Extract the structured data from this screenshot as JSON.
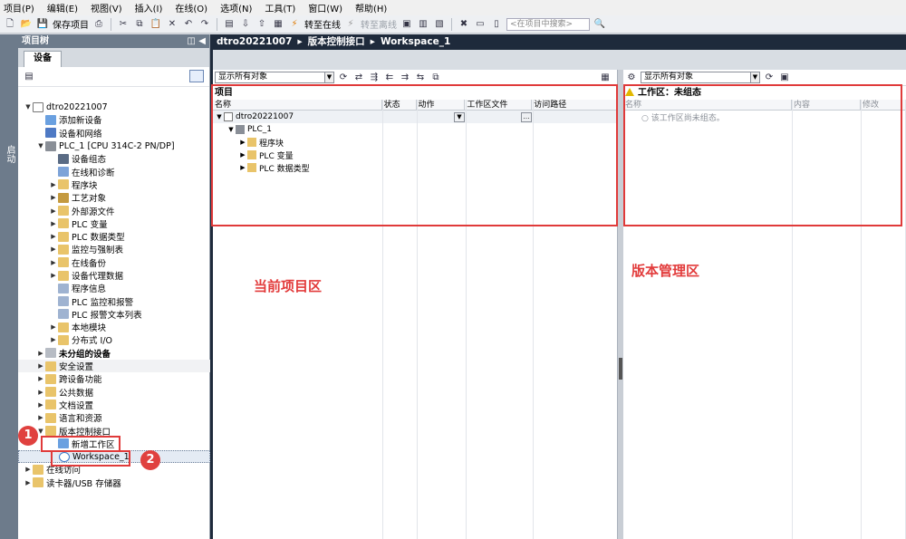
{
  "menu": [
    "项目(P)",
    "编辑(E)",
    "视图(V)",
    "插入(I)",
    "在线(O)",
    "选项(N)",
    "工具(T)",
    "窗口(W)",
    "帮助(H)"
  ],
  "toolbar": {
    "save_label": "保存项目",
    "go_online": "转至在线",
    "go_offline": "转至离线",
    "search_placeholder": "<在项目中搜索>"
  },
  "side_strip": {
    "label": "启动"
  },
  "tree": {
    "header": "项目树",
    "tab": "设备",
    "items": [
      {
        "label": "dtro20221007",
        "indent": 0,
        "arrow": "▼",
        "icon": "project"
      },
      {
        "label": "添加新设备",
        "indent": 1,
        "arrow": "",
        "icon": "add"
      },
      {
        "label": "设备和网络",
        "indent": 1,
        "arrow": "",
        "icon": "net"
      },
      {
        "label": "PLC_1 [CPU 314C-2 PN/DP]",
        "indent": 1,
        "arrow": "▼",
        "icon": "plc"
      },
      {
        "label": "设备组态",
        "indent": 2,
        "arrow": "",
        "icon": "cfg"
      },
      {
        "label": "在线和诊断",
        "indent": 2,
        "arrow": "",
        "icon": "diag"
      },
      {
        "label": "程序块",
        "indent": 2,
        "arrow": "▶",
        "icon": "folder"
      },
      {
        "label": "工艺对象",
        "indent": 2,
        "arrow": "▶",
        "icon": "tech"
      },
      {
        "label": "外部源文件",
        "indent": 2,
        "arrow": "▶",
        "icon": "folder"
      },
      {
        "label": "PLC 变量",
        "indent": 2,
        "arrow": "▶",
        "icon": "folder"
      },
      {
        "label": "PLC 数据类型",
        "indent": 2,
        "arrow": "▶",
        "icon": "folder"
      },
      {
        "label": "监控与强制表",
        "indent": 2,
        "arrow": "▶",
        "icon": "folder"
      },
      {
        "label": "在线备份",
        "indent": 2,
        "arrow": "▶",
        "icon": "folder"
      },
      {
        "label": "设备代理数据",
        "indent": 2,
        "arrow": "▶",
        "icon": "folder"
      },
      {
        "label": "程序信息",
        "indent": 2,
        "arrow": "",
        "icon": "info"
      },
      {
        "label": "PLC 监控和报警",
        "indent": 2,
        "arrow": "",
        "icon": "info"
      },
      {
        "label": "PLC 报警文本列表",
        "indent": 2,
        "arrow": "",
        "icon": "info"
      },
      {
        "label": "本地模块",
        "indent": 2,
        "arrow": "▶",
        "icon": "folder"
      },
      {
        "label": "分布式 I/O",
        "indent": 2,
        "arrow": "▶",
        "icon": "folder"
      },
      {
        "label": "未分组的设备",
        "indent": 1,
        "arrow": "▶",
        "icon": "dev",
        "style": "bold"
      },
      {
        "label": "安全设置",
        "indent": 1,
        "arrow": "▶",
        "icon": "folder",
        "style": "shaded"
      },
      {
        "label": "跨设备功能",
        "indent": 1,
        "arrow": "▶",
        "icon": "folder"
      },
      {
        "label": "公共数据",
        "indent": 1,
        "arrow": "▶",
        "icon": "folder"
      },
      {
        "label": "文档设置",
        "indent": 1,
        "arrow": "▶",
        "icon": "folder"
      },
      {
        "label": "语言和资源",
        "indent": 1,
        "arrow": "▶",
        "icon": "folder"
      },
      {
        "label": "版本控制接口",
        "indent": 1,
        "arrow": "▼",
        "icon": "folder"
      },
      {
        "label": "新增工作区",
        "indent": 2,
        "arrow": "",
        "icon": "add"
      },
      {
        "label": "Workspace_1",
        "indent": 2,
        "arrow": "",
        "icon": "ws",
        "style": "selected"
      },
      {
        "label": "在线访问",
        "indent": 0,
        "arrow": "▶",
        "icon": "folder"
      },
      {
        "label": "读卡器/USB 存储器",
        "indent": 0,
        "arrow": "▶",
        "icon": "folder"
      }
    ]
  },
  "callouts": [
    "1",
    "2"
  ],
  "breadcrumb": [
    "dtro20221007",
    "版本控制接口",
    "Workspace_1"
  ],
  "left_editor": {
    "filter": "显示所有对象",
    "section_title": "项目",
    "columns": [
      "名称",
      "状态",
      "动作",
      "工作区文件",
      "访问路径"
    ],
    "rows": [
      {
        "label": "dtro20221007",
        "indent": 0,
        "arrow": "▼"
      },
      {
        "label": "PLC_1",
        "indent": 1,
        "arrow": "▼"
      },
      {
        "label": "程序块",
        "indent": 2,
        "arrow": "▶"
      },
      {
        "label": "PLC 变量",
        "indent": 2,
        "arrow": "▶"
      },
      {
        "label": "PLC 数据类型",
        "indent": 2,
        "arrow": "▶"
      }
    ],
    "annotation": "当前项目区"
  },
  "right_editor": {
    "filter": "显示所有对象",
    "section_title": "工作区：未组态",
    "columns": [
      "名称",
      "内容",
      "修改"
    ],
    "placeholder_row": "○ 该工作区尚未组态。",
    "annotation": "版本管理区"
  }
}
